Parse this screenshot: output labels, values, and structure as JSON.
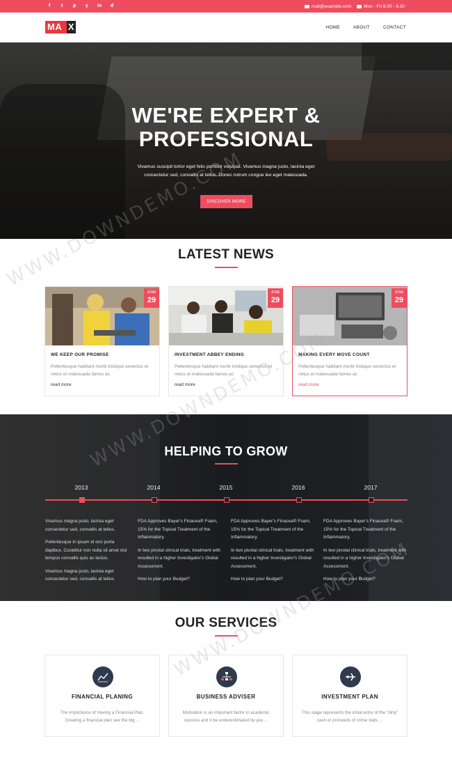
{
  "topbar": {
    "socials": [
      "f",
      "t",
      "p",
      "y",
      "in",
      "d"
    ],
    "email": "mail@example.com",
    "hours": "Mon - Fri 8.00 - 6.30"
  },
  "header": {
    "logo": "MA",
    "logo_x": "X",
    "nav": [
      "HOME",
      "ABOUT",
      "CONTACT"
    ]
  },
  "hero": {
    "title_line1": "WE'RE EXPERT &",
    "title_line2": "PROFESSIONAL",
    "text": "Vivamus suscipit tortor eget felis porttitor volutpat. Vivamus magna justo, lacinia eget consectetur sed, convallis at tellus. Donec rutrum congue leo eget malesuada.",
    "button": "DISCOVER MORE"
  },
  "news": {
    "title": "LATEST NEWS",
    "cards": [
      {
        "month": "JUNE",
        "day": "29",
        "title": "WE KEEP OUR PROMISE",
        "text": "Pellentesque habitant morbi tristique senectus et netus et malesuada fames ac",
        "link": "read more"
      },
      {
        "month": "JUNE",
        "day": "29",
        "title": "INVESTMENT ABBEY ENDING",
        "text": "Pellentesque habitant morbi tristique senectus et netus et malesuada fames ac",
        "link": "read more"
      },
      {
        "month": "JUNE",
        "day": "29",
        "title": "MAKING EVERY MOVE COUNT",
        "text": "Pellentesque habitant morbi tristique senectus et netus et malesuada fames ac",
        "link": "read more"
      }
    ]
  },
  "grow": {
    "title": "HELPING TO GROW",
    "years": [
      "2013",
      "2014",
      "2015",
      "2016",
      "2017"
    ],
    "columns": [
      [
        "Vivamus magna justo, lacinia eget consectetur sed, convallis at tellus.",
        "Pellentesque in ipsum id orci porta dapibus. Curabitur non nulla sit amet nisl tempus convallis quis ac lectus.",
        "Vivamus magna justo, lacinia eget consectetur sed, convallis at tellus."
      ],
      [
        "FDA Approves Bayer's Finacea® Foam, 15% for the Topical Treatment of the Inflammatory.",
        "In two pivotal clinical trials, treatment with resulted in a higher Investigator's Global Assessment.",
        "How to plan your Budget?"
      ],
      [
        "FDA Approves Bayer's Finacea® Foam, 15% for the Topical Treatment of the Inflammatory.",
        "In two pivotal clinical trials, treatment with resulted in a higher Investigator's Global Assessment.",
        "How to plan your Budget?"
      ],
      [
        "FDA Approves Bayer's Finacea® Foam, 15% for the Topical Treatment of the Inflammatory.",
        "In two pivotal clinical trials, treatment with resulted in a higher Investigator's Global Assessment.",
        "How to plan your Budget?"
      ]
    ]
  },
  "services": {
    "title": "OUR SERVICES",
    "items": [
      {
        "icon": "chart-icon",
        "title": "FINANCIAL PLANING",
        "text": "The Importance of Having a Financial Plan. Creating a financial plan see the big ..."
      },
      {
        "icon": "org-chart-icon",
        "title": "BUSINESS ADVISER",
        "text": "Motivation is an important factor in academic success and it be underestimated by you ..."
      },
      {
        "icon": "plane-icon",
        "title": "INVESTMENT PLAN",
        "text": "This stage represents the initial entry of the \"dirty\" cash or proceeds of crime stats ..."
      }
    ]
  },
  "watermark": "WWW.DOWNDEMO.COM",
  "colors": {
    "accent": "#ee4d5f",
    "dark": "#1f2024",
    "icon_bg": "#2f3a4d"
  }
}
